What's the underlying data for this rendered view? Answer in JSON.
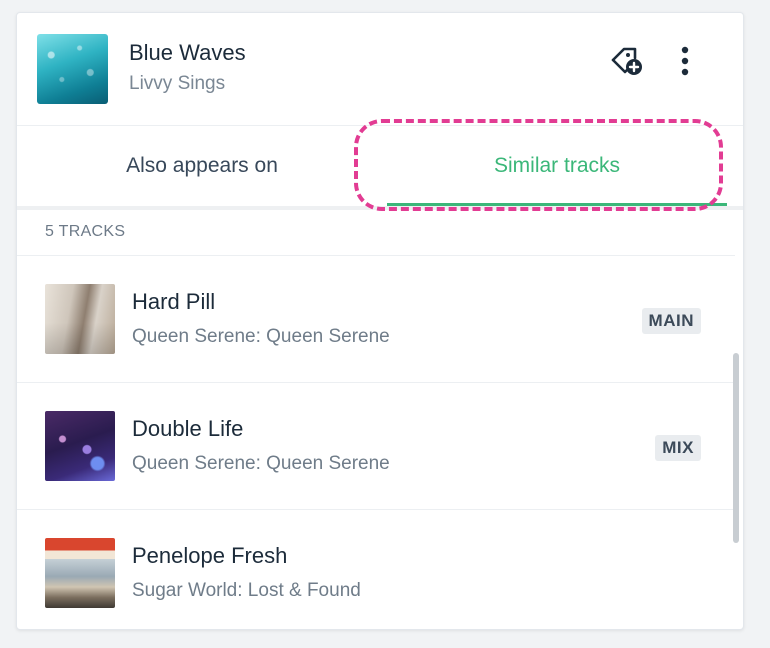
{
  "now_playing": {
    "title": "Blue Waves",
    "artist": "Livvy Sings",
    "cover_icon": "album-cover-water"
  },
  "actions": {
    "tag_icon": "tag-add-icon",
    "more_icon": "more-vertical-icon"
  },
  "tabs": [
    {
      "label": "Also appears on",
      "active": false
    },
    {
      "label": "Similar tracks",
      "active": true
    }
  ],
  "track_count": "5 TRACKS",
  "tracks": [
    {
      "title": "Hard Pill",
      "subtitle": "Queen Serene: Queen Serene",
      "badge": "MAIN"
    },
    {
      "title": "Double Life",
      "subtitle": "Queen Serene: Queen Serene",
      "badge": "MIX"
    },
    {
      "title": "Penelope Fresh",
      "subtitle": "Sugar World: Lost & Found",
      "badge": ""
    }
  ],
  "colors": {
    "accent": "#3bb779",
    "highlight": "#e23c93",
    "text_primary": "#1c2b3a",
    "text_secondary": "#6f7c89",
    "badge_bg": "#e9ecef"
  }
}
